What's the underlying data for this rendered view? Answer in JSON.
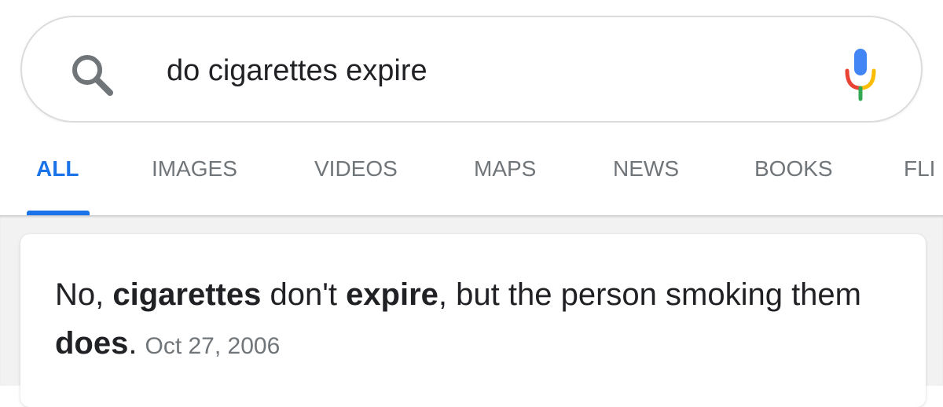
{
  "search": {
    "query": "do cigarettes expire"
  },
  "tabs": [
    {
      "label": "ALL",
      "active": true
    },
    {
      "label": "IMAGES",
      "active": false
    },
    {
      "label": "VIDEOS",
      "active": false
    },
    {
      "label": "MAPS",
      "active": false
    },
    {
      "label": "NEWS",
      "active": false
    },
    {
      "label": "BOOKS",
      "active": false
    },
    {
      "label": "FLI",
      "active": false
    }
  ],
  "answer": {
    "segments": [
      {
        "text": "No, ",
        "bold": false
      },
      {
        "text": "cigarettes",
        "bold": true
      },
      {
        "text": " don't ",
        "bold": false
      },
      {
        "text": "expire",
        "bold": true
      },
      {
        "text": ", but the person smoking them ",
        "bold": false
      },
      {
        "text": "does",
        "bold": true
      },
      {
        "text": ".",
        "bold": false
      }
    ],
    "date": "Oct 27, 2006"
  },
  "icons": {
    "search": "search-icon",
    "mic": "microphone-icon"
  },
  "colors": {
    "accent": "#1a73e8",
    "tab_inactive": "#70757a",
    "text": "#202124",
    "mic_blue": "#4285f4",
    "mic_red": "#ea4335",
    "mic_yellow": "#fbbc05",
    "mic_green": "#34a853"
  }
}
